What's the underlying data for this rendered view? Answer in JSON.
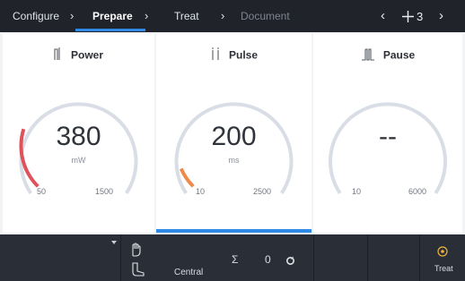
{
  "breadcrumb": {
    "steps": [
      {
        "label": "Configure",
        "state": "done"
      },
      {
        "label": "Prepare",
        "state": "active"
      },
      {
        "label": "Treat",
        "state": "done"
      },
      {
        "label": "Document",
        "state": "disabled"
      }
    ],
    "separator": "›"
  },
  "pager": {
    "prev": "‹",
    "next": "›",
    "count": "3",
    "add_icon": "crosshair-plus-icon"
  },
  "panels": {
    "power": {
      "title": "Power",
      "icon": "power-pulse-icon",
      "value": "380",
      "unit": "mW",
      "min": "50",
      "max": "1500",
      "level": 0.23,
      "fill_color": "#e0525a"
    },
    "pulse": {
      "title": "Pulse",
      "icon": "pulse-duration-icon",
      "value": "200",
      "unit": "ms",
      "min": "10",
      "max": "2500",
      "level": 0.08,
      "fill_color": "#f08a4b"
    },
    "pause": {
      "title": "Pause",
      "icon": "pause-interval-icon",
      "value": "--",
      "unit": "",
      "min": "10",
      "max": "6000",
      "level": 0,
      "fill_color": "#cccccc"
    }
  },
  "bottombar": {
    "position_label": "Central",
    "sigma_symbol": "Σ",
    "counter": "0",
    "treat_label": "Treat",
    "icons": [
      "hand-icon",
      "foot-pedal-icon",
      "reset-icon",
      "treat-target-icon"
    ]
  },
  "colors": {
    "accent": "#2e8ae6",
    "bar_bg": "#20232a",
    "track": "#d9dee6"
  }
}
